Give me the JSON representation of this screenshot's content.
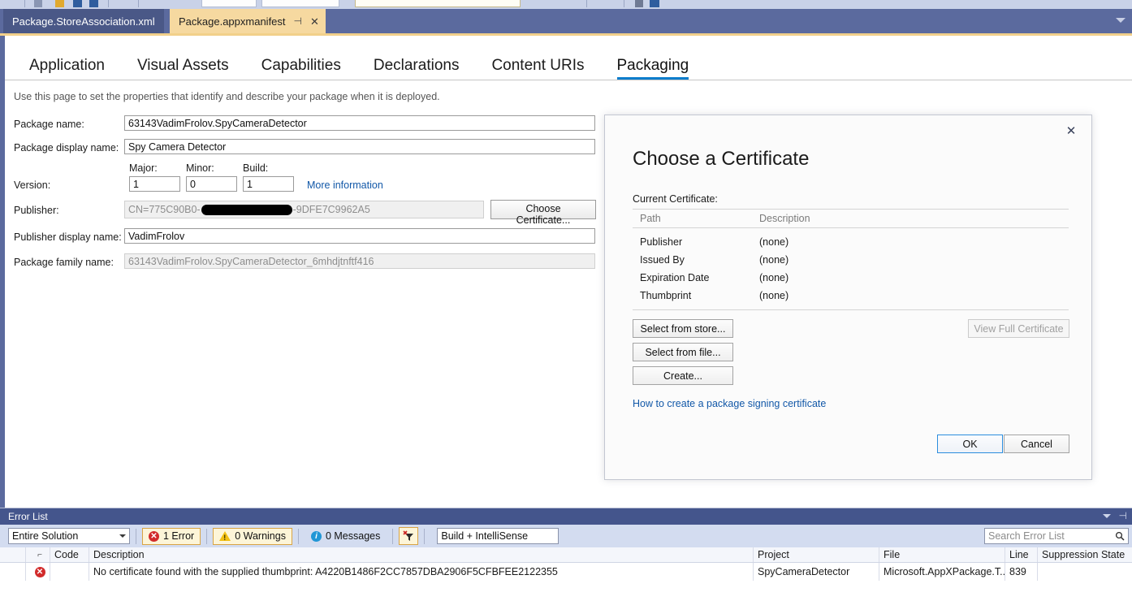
{
  "window": {
    "doc_tabs": [
      {
        "label": "Package.StoreAssociation.xml",
        "active": false
      },
      {
        "label": "Package.appxmanifest",
        "active": true,
        "pin_icon": "pin-icon",
        "close_icon": "close-icon"
      }
    ],
    "tabstrip_overflow_icon": "chevron-down-icon"
  },
  "designer": {
    "nav_tabs": [
      {
        "label": "Application",
        "selected": false
      },
      {
        "label": "Visual Assets",
        "selected": false
      },
      {
        "label": "Capabilities",
        "selected": false
      },
      {
        "label": "Declarations",
        "selected": false
      },
      {
        "label": "Content URIs",
        "selected": false
      },
      {
        "label": "Packaging",
        "selected": true
      }
    ],
    "description": "Use this page to set the properties that identify and describe your package when it is deployed.",
    "fields": {
      "package_name_label": "Package name:",
      "package_name_value": "63143VadimFrolov.SpyCameraDetector",
      "package_display_name_label": "Package display name:",
      "package_display_name_value": "Spy Camera Detector",
      "version_label": "Version:",
      "major_caption": "Major:",
      "minor_caption": "Minor:",
      "build_caption": "Build:",
      "major_value": "1",
      "minor_value": "0",
      "build_value": "1",
      "more_information_link": "More information",
      "publisher_label": "Publisher:",
      "publisher_value_prefix": "CN=775C90B0-",
      "publisher_value_suffix": "-9DFE7C9962A5",
      "choose_certificate_button": "Choose Certificate...",
      "publisher_display_name_label": "Publisher display name:",
      "publisher_display_name_value": "VadimFrolov",
      "package_family_name_label": "Package family name:",
      "package_family_name_value": "63143VadimFrolov.SpyCameraDetector_6mhdjtnftf416"
    }
  },
  "dialog": {
    "close_icon": "close-icon",
    "title": "Choose a Certificate",
    "current_certificate_label": "Current Certificate:",
    "table": {
      "headers": [
        "Path",
        "Description"
      ],
      "rows": [
        {
          "path": "Publisher",
          "description": "(none)"
        },
        {
          "path": "Issued By",
          "description": "(none)"
        },
        {
          "path": "Expiration Date",
          "description": "(none)"
        },
        {
          "path": "Thumbprint",
          "description": "(none)"
        }
      ]
    },
    "select_from_store_button": "Select from store...",
    "select_from_file_button": "Select from file...",
    "create_button": "Create...",
    "view_full_certificate_button": "View Full Certificate",
    "help_link": "How to create a package signing certificate",
    "ok_button": "OK",
    "cancel_button": "Cancel"
  },
  "error_list": {
    "title": "Error List",
    "collapse_icon": "chevron-down-icon",
    "pin_icon": "pin-icon",
    "scope_value": "Entire Solution",
    "errors_toggle": "1 Error",
    "warnings_toggle": "0 Warnings",
    "messages_toggle": "0 Messages",
    "filter_icon": "clear-filter-icon",
    "build_filter_value": "Build + IntelliSense",
    "search_placeholder": "Search Error List",
    "search_icon": "search-icon",
    "columns": [
      "",
      "",
      "Code",
      "Description",
      "Project",
      "File",
      "Line",
      "Suppression State"
    ],
    "rows": [
      {
        "severity_icon": "error-icon",
        "code": "",
        "description": "No certificate found with the supplied thumbprint: A4220B1486F2CC7857DBA2906F5CFBFEE2122355",
        "project": "SpyCameraDetector",
        "file": "Microsoft.AppXPackage.T...",
        "line": "839",
        "suppression_state": ""
      }
    ]
  },
  "colors": {
    "tabstrip_bg": "#5b6a9e",
    "active_tab_bg": "#f6d9a0",
    "accent_underline": "#0c7dcc",
    "error_red": "#d22b2b",
    "warning_yellow": "#f2c014",
    "info_blue": "#2196d6",
    "panel_title_bg": "#44558c",
    "link_blue": "#1258a8"
  }
}
